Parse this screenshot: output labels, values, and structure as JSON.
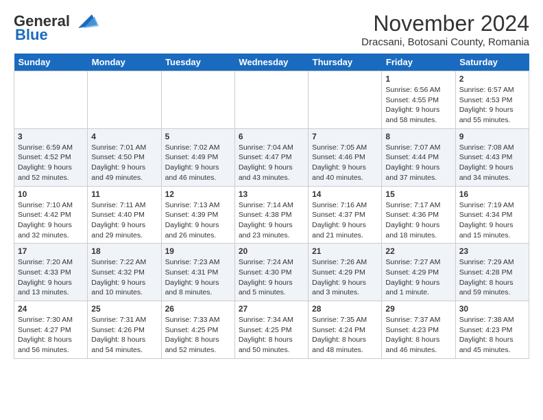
{
  "header": {
    "logo_general": "General",
    "logo_blue": "Blue",
    "month_title": "November 2024",
    "location": "Dracsani, Botosani County, Romania"
  },
  "calendar": {
    "days_of_week": [
      "Sunday",
      "Monday",
      "Tuesday",
      "Wednesday",
      "Thursday",
      "Friday",
      "Saturday"
    ],
    "weeks": [
      [
        {
          "day": "",
          "info": ""
        },
        {
          "day": "",
          "info": ""
        },
        {
          "day": "",
          "info": ""
        },
        {
          "day": "",
          "info": ""
        },
        {
          "day": "",
          "info": ""
        },
        {
          "day": "1",
          "info": "Sunrise: 6:56 AM\nSunset: 4:55 PM\nDaylight: 9 hours and 58 minutes."
        },
        {
          "day": "2",
          "info": "Sunrise: 6:57 AM\nSunset: 4:53 PM\nDaylight: 9 hours and 55 minutes."
        }
      ],
      [
        {
          "day": "3",
          "info": "Sunrise: 6:59 AM\nSunset: 4:52 PM\nDaylight: 9 hours and 52 minutes."
        },
        {
          "day": "4",
          "info": "Sunrise: 7:01 AM\nSunset: 4:50 PM\nDaylight: 9 hours and 49 minutes."
        },
        {
          "day": "5",
          "info": "Sunrise: 7:02 AM\nSunset: 4:49 PM\nDaylight: 9 hours and 46 minutes."
        },
        {
          "day": "6",
          "info": "Sunrise: 7:04 AM\nSunset: 4:47 PM\nDaylight: 9 hours and 43 minutes."
        },
        {
          "day": "7",
          "info": "Sunrise: 7:05 AM\nSunset: 4:46 PM\nDaylight: 9 hours and 40 minutes."
        },
        {
          "day": "8",
          "info": "Sunrise: 7:07 AM\nSunset: 4:44 PM\nDaylight: 9 hours and 37 minutes."
        },
        {
          "day": "9",
          "info": "Sunrise: 7:08 AM\nSunset: 4:43 PM\nDaylight: 9 hours and 34 minutes."
        }
      ],
      [
        {
          "day": "10",
          "info": "Sunrise: 7:10 AM\nSunset: 4:42 PM\nDaylight: 9 hours and 32 minutes."
        },
        {
          "day": "11",
          "info": "Sunrise: 7:11 AM\nSunset: 4:40 PM\nDaylight: 9 hours and 29 minutes."
        },
        {
          "day": "12",
          "info": "Sunrise: 7:13 AM\nSunset: 4:39 PM\nDaylight: 9 hours and 26 minutes."
        },
        {
          "day": "13",
          "info": "Sunrise: 7:14 AM\nSunset: 4:38 PM\nDaylight: 9 hours and 23 minutes."
        },
        {
          "day": "14",
          "info": "Sunrise: 7:16 AM\nSunset: 4:37 PM\nDaylight: 9 hours and 21 minutes."
        },
        {
          "day": "15",
          "info": "Sunrise: 7:17 AM\nSunset: 4:36 PM\nDaylight: 9 hours and 18 minutes."
        },
        {
          "day": "16",
          "info": "Sunrise: 7:19 AM\nSunset: 4:34 PM\nDaylight: 9 hours and 15 minutes."
        }
      ],
      [
        {
          "day": "17",
          "info": "Sunrise: 7:20 AM\nSunset: 4:33 PM\nDaylight: 9 hours and 13 minutes."
        },
        {
          "day": "18",
          "info": "Sunrise: 7:22 AM\nSunset: 4:32 PM\nDaylight: 9 hours and 10 minutes."
        },
        {
          "day": "19",
          "info": "Sunrise: 7:23 AM\nSunset: 4:31 PM\nDaylight: 9 hours and 8 minutes."
        },
        {
          "day": "20",
          "info": "Sunrise: 7:24 AM\nSunset: 4:30 PM\nDaylight: 9 hours and 5 minutes."
        },
        {
          "day": "21",
          "info": "Sunrise: 7:26 AM\nSunset: 4:29 PM\nDaylight: 9 hours and 3 minutes."
        },
        {
          "day": "22",
          "info": "Sunrise: 7:27 AM\nSunset: 4:29 PM\nDaylight: 9 hours and 1 minute."
        },
        {
          "day": "23",
          "info": "Sunrise: 7:29 AM\nSunset: 4:28 PM\nDaylight: 8 hours and 59 minutes."
        }
      ],
      [
        {
          "day": "24",
          "info": "Sunrise: 7:30 AM\nSunset: 4:27 PM\nDaylight: 8 hours and 56 minutes."
        },
        {
          "day": "25",
          "info": "Sunrise: 7:31 AM\nSunset: 4:26 PM\nDaylight: 8 hours and 54 minutes."
        },
        {
          "day": "26",
          "info": "Sunrise: 7:33 AM\nSunset: 4:25 PM\nDaylight: 8 hours and 52 minutes."
        },
        {
          "day": "27",
          "info": "Sunrise: 7:34 AM\nSunset: 4:25 PM\nDaylight: 8 hours and 50 minutes."
        },
        {
          "day": "28",
          "info": "Sunrise: 7:35 AM\nSunset: 4:24 PM\nDaylight: 8 hours and 48 minutes."
        },
        {
          "day": "29",
          "info": "Sunrise: 7:37 AM\nSunset: 4:23 PM\nDaylight: 8 hours and 46 minutes."
        },
        {
          "day": "30",
          "info": "Sunrise: 7:38 AM\nSunset: 4:23 PM\nDaylight: 8 hours and 45 minutes."
        }
      ]
    ]
  }
}
